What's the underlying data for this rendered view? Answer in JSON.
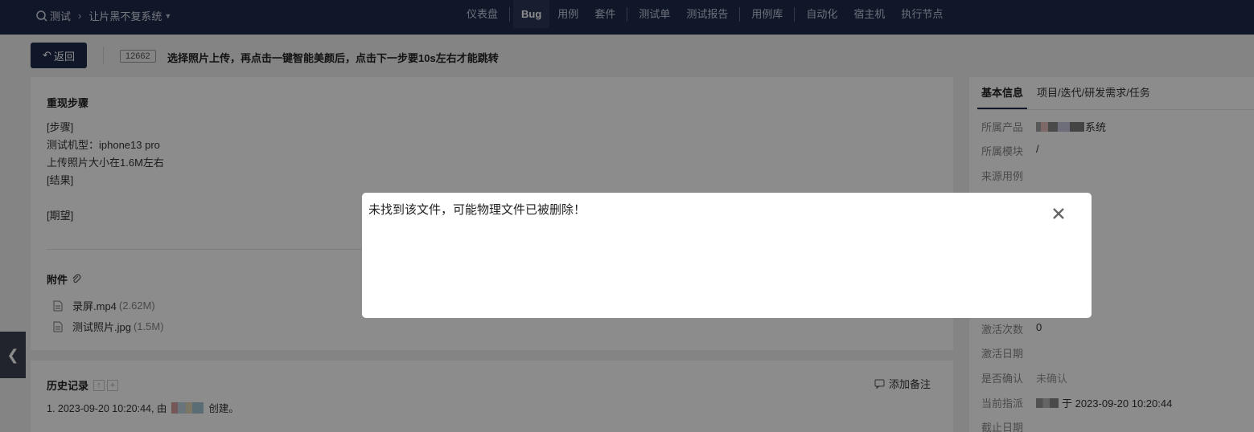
{
  "topnav": {
    "product_root": "测试",
    "product_name": "让片黑不复系统",
    "items": [
      {
        "label": "仪表盘"
      },
      {
        "label": "Bug",
        "active": true
      },
      {
        "label": "用例"
      },
      {
        "label": "套件"
      },
      {
        "label": "测试单"
      },
      {
        "label": "测试报告"
      },
      {
        "label": "用例库"
      },
      {
        "label": "自动化"
      },
      {
        "label": "宿主机"
      },
      {
        "label": "执行节点"
      }
    ]
  },
  "header": {
    "back_label": "返回",
    "bug_id": "12662",
    "title": "选择照片上传，再点击一键智能美颜后，点击下一步要10s左右才能跳转"
  },
  "steps": {
    "title": "重现步骤",
    "lines": [
      "[步骤]",
      "测试机型：iphone13 pro",
      "上传照片大小在1.6M左右",
      "[结果]",
      "",
      "[期望]"
    ]
  },
  "attachments": {
    "title": "附件",
    "files": [
      {
        "name": "录屏.mp4",
        "size": "(2.62M)"
      },
      {
        "name": "测试照片.jpg",
        "size": "(1.5M)"
      }
    ]
  },
  "history": {
    "title": "历史记录",
    "add_note": "添加备注",
    "entries": [
      {
        "prefix": "1. 2023-09-20 10:20:44, 由",
        "suffix": "创建。"
      }
    ]
  },
  "info": {
    "tabs": [
      "基本信息",
      "项目/迭代/研发需求/任务"
    ],
    "rows": [
      {
        "key": "所属产品",
        "value": "系统"
      },
      {
        "key": "所属模块",
        "value": "/"
      },
      {
        "key": "来源用例",
        "value": ""
      },
      {
        "key": "激活次数",
        "value": "0"
      },
      {
        "key": "激活日期",
        "value": ""
      },
      {
        "key": "是否确认",
        "value": "未确认"
      },
      {
        "key": "当前指派",
        "value": "于 2023-09-20 10:20:44"
      },
      {
        "key": "截止日期",
        "value": ""
      }
    ]
  },
  "modal": {
    "message": "未找到该文件，可能物理文件已被删除！"
  },
  "colors": {
    "nav_bg": "#1e2b4a",
    "overlay": "rgba(0,0,0,0.45)"
  }
}
